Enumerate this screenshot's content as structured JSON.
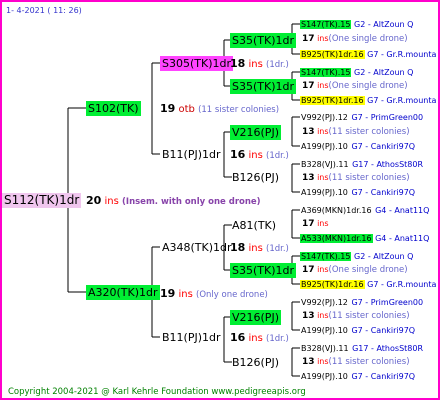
{
  "date": "1-  4-2021 ( 11: 26)",
  "copyright": "Copyright 2004-2021 @ Karl Kehrle Foundation    www.pedigreeapis.org",
  "root": {
    "name": "S112(TK)1dr",
    "count": "20",
    "unit": "ins",
    "note": "(Insem. with only one drone)"
  },
  "dam": {
    "name": "S102(TK)",
    "count": "19",
    "unit": "otb",
    "note": "(11 sister colonies)",
    "dam": {
      "name": "S305(TK)1dr",
      "count": "18",
      "unit": "ins",
      "note": "(1dr.)",
      "dam": {
        "name": "S35(TK)1dr",
        "count": "17",
        "unit": "ins",
        "note": "(One single drone)"
      },
      "sire": {
        "name": "S35(TK)1dr",
        "count": "17",
        "unit": "ins",
        "note": "(One single drone)"
      }
    },
    "sire": {
      "name": "B11(PJ)1dr",
      "count": "16",
      "unit": "ins",
      "note": "(1dr.)",
      "dam": {
        "name": "V216(PJ)",
        "count": "13",
        "unit": "ins",
        "note": "(11 sister colonies)"
      },
      "sire": {
        "name": "B126(PJ)",
        "count": "13",
        "unit": "ins",
        "note": "(11 sister colonies)"
      }
    }
  },
  "sire": {
    "name": "A320(TK)1dr",
    "count": "19",
    "unit": "ins",
    "note": "(Only one drone)",
    "dam": {
      "name": "A348(TK)1dr",
      "count": "18",
      "unit": "ins",
      "note": "(1dr.)",
      "dam": {
        "name": "A81(TK)",
        "count": "17",
        "unit": "ins",
        "note": ""
      },
      "sire": {
        "name": "S35(TK)1dr",
        "count": "17",
        "unit": "ins",
        "note": "(One single drone)"
      }
    },
    "sire": {
      "name": "B11(PJ)1dr",
      "count": "16",
      "unit": "ins",
      "note": "(1dr.)",
      "dam": {
        "name": "V216(PJ)",
        "count": "13",
        "unit": "ins",
        "note": "(11 sister colonies)"
      },
      "sire": {
        "name": "B126(PJ)",
        "count": "13",
        "unit": "ins",
        "note": "(11 sister colonies)"
      }
    }
  },
  "leaves": [
    {
      "name": "S147(TK).15",
      "info": "G2 - AltZoun Q"
    },
    {
      "name": "B925(TK)1dr.16",
      "info": "G7 - Gr.R.mounta"
    },
    {
      "name": "S147(TK).15",
      "info": "G2 - AltZoun Q"
    },
    {
      "name": "B925(TK)1dr.16",
      "info": "G7 - Gr.R.mounta"
    },
    {
      "name": "V992(PJ).12",
      "info": "G7 - PrimGreen00"
    },
    {
      "name": "A199(PJ).10",
      "info": "G7 - Cankiri97Q"
    },
    {
      "name": "B328(VJ).11",
      "info": "G17 - AthosSt80R"
    },
    {
      "name": "A199(PJ).10",
      "info": "G7 - Cankiri97Q"
    },
    {
      "name": "A369(MKN)1dr.16",
      "info": "G4 - Anat11Q"
    },
    {
      "name": "A533(MKN)1dr.16",
      "info": "G4 - Anat11Q"
    },
    {
      "name": "S147(TK).15",
      "info": "G2 - AltZoun Q"
    },
    {
      "name": "B925(TK)1dr.16",
      "info": "G7 - Gr.R.mounta"
    },
    {
      "name": "V992(PJ).12",
      "info": "G7 - PrimGreen00"
    },
    {
      "name": "A199(PJ).10",
      "info": "G7 - Cankiri97Q"
    },
    {
      "name": "B328(VJ).11",
      "info": "G17 - AthosSt80R"
    },
    {
      "name": "A199(PJ).10",
      "info": "G7 - Cankiri97Q"
    }
  ],
  "leaf_counts": [
    {
      "count": "17",
      "unit": "ins",
      "note": "(One single drone)"
    },
    {
      "count": "17",
      "unit": "ins",
      "note": "(One single drone)"
    },
    {
      "count": "13",
      "unit": "ins",
      "note": "(11 sister colonies)"
    },
    {
      "count": "13",
      "unit": "ins",
      "note": "(11 sister colonies)"
    },
    {
      "count": "17",
      "unit": "ins",
      "note": ""
    },
    {
      "count": "17",
      "unit": "ins",
      "note": "(One single drone)"
    },
    {
      "count": "13",
      "unit": "ins",
      "note": "(11 sister colonies)"
    },
    {
      "count": "13",
      "unit": "ins",
      "note": "(11 sister colonies)"
    }
  ],
  "colors": {
    "frame": "#ff00cc",
    "queen_bg": "#00ee33",
    "root_bg": "#f0c6ee",
    "sire_bg": "#ff44ff",
    "drone_bg": "#ffff00",
    "ins": "#ff0000",
    "info": "#0000cc"
  }
}
